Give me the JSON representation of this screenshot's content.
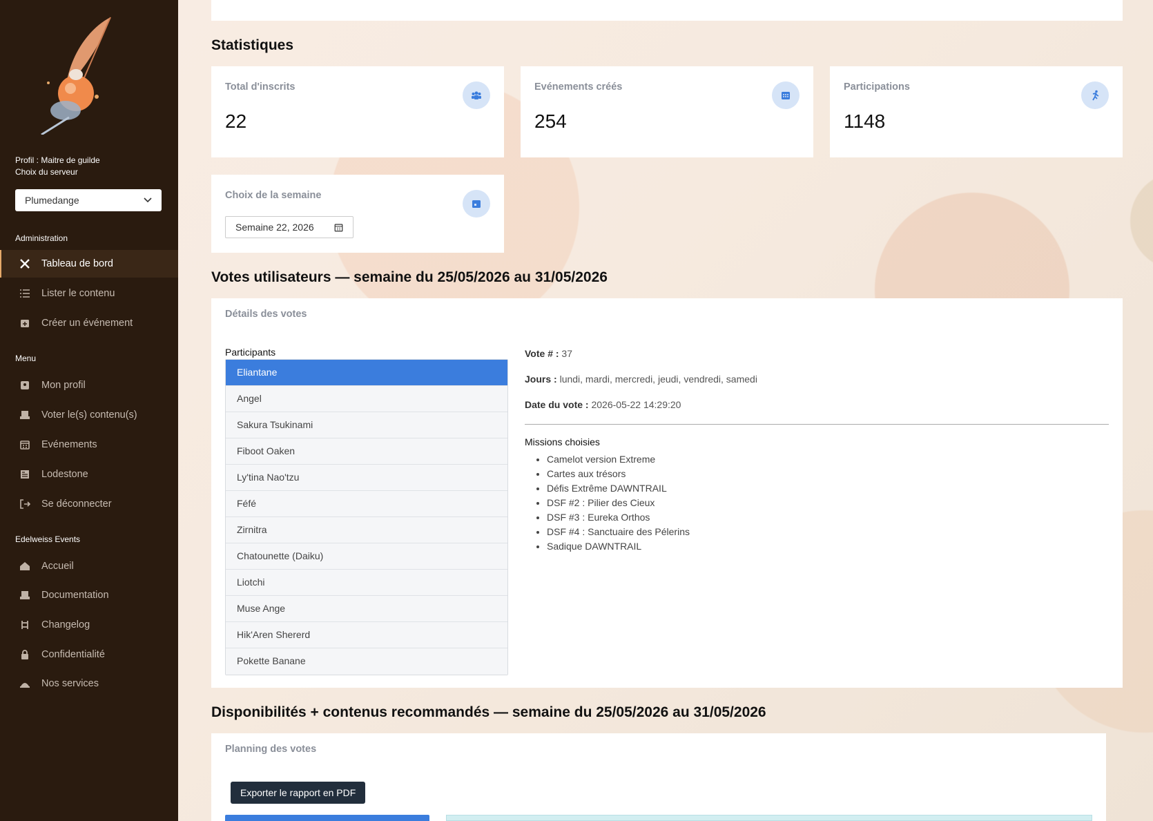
{
  "sidebar": {
    "profile_line": "Profil : Maitre de guilde",
    "server_label": "Choix du serveur",
    "server_value": "Plumedange",
    "sections": {
      "administration": "Administration",
      "menu": "Menu",
      "edelweiss": "Edelweiss Events"
    },
    "admin_items": [
      {
        "label": "Tableau de bord",
        "icon": "tools-icon"
      },
      {
        "label": "Lister le contenu",
        "icon": "list-icon"
      },
      {
        "label": "Créer un événement",
        "icon": "calendar-plus-icon"
      }
    ],
    "menu_items": [
      {
        "label": "Mon profil",
        "icon": "user-card-icon"
      },
      {
        "label": "Voter le(s) contenu(s)",
        "icon": "vote-icon"
      },
      {
        "label": "Evénements",
        "icon": "calendar-icon"
      },
      {
        "label": "Lodestone",
        "icon": "newspaper-icon"
      },
      {
        "label": "Se déconnecter",
        "icon": "logout-icon"
      }
    ],
    "edelweiss_items": [
      {
        "label": "Accueil",
        "icon": "home-icon"
      },
      {
        "label": "Documentation",
        "icon": "book-icon"
      },
      {
        "label": "Changelog",
        "icon": "changelog-icon"
      },
      {
        "label": "Confidentialité",
        "icon": "lock-icon"
      },
      {
        "label": "Nos services",
        "icon": "services-icon"
      }
    ]
  },
  "stats": {
    "heading": "Statistiques",
    "cards": [
      {
        "title": "Total d'inscrits",
        "value": "22",
        "icon": "users-icon"
      },
      {
        "title": "Evénements créés",
        "value": "254",
        "icon": "calendar-icon"
      },
      {
        "title": "Participations",
        "value": "1148",
        "icon": "running-icon"
      }
    ],
    "week": {
      "title": "Choix de la semaine",
      "value": "Semaine 22, 2026",
      "icon": "calendar-check-icon"
    }
  },
  "votes": {
    "heading": "Votes utilisateurs — semaine du 25/05/2026 au 31/05/2026",
    "card_title": "Détails des votes",
    "participants_label": "Participants",
    "participants": [
      "Eliantane",
      "Angel",
      "Sakura Tsukinami",
      "Fiboot Oaken",
      "Ly'tina Nao'tzu",
      "Féfé",
      "Zirnitra",
      "Chatounette (Daiku)",
      "Liotchi",
      "Muse Ange",
      "Hik'Aren Shererd",
      "Pokette Banane"
    ],
    "selected_index": 0,
    "vote_no_label": "Vote # :",
    "vote_no": "37",
    "days_label": "Jours :",
    "days": "lundi, mardi, mercredi, jeudi, vendredi, samedi",
    "date_label": "Date du vote :",
    "date": "2026-05-22 14:29:20",
    "missions_title": "Missions choisies",
    "missions": [
      "Camelot version Extreme",
      "Cartes aux trésors",
      "Défis Extrême DAWNTRAIL",
      "DSF #2 : Pilier des Cieux",
      "DSF #3 : Eureka Orthos",
      "DSF #4 : Sanctuaire des Pélerins",
      "Sadique DAWNTRAIL"
    ]
  },
  "availability": {
    "heading": "Disponibilités + contenus recommandés — semaine du 25/05/2026 au 31/05/2026",
    "card_title": "Planning des votes",
    "export_label": "Exporter le rapport en PDF"
  }
}
